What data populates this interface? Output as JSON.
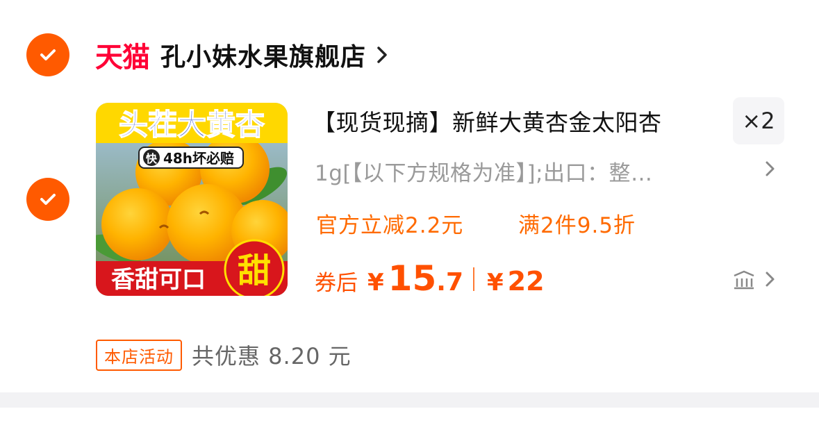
{
  "shop": {
    "platform": "天猫",
    "name": "孔小妹水果旗舰店"
  },
  "image_text": {
    "headline": "头茬大黄杏",
    "badge_kuai": "快",
    "badge_text": "48h坏必赔",
    "bottom_left": "香甜可口",
    "bottom_right": "甜"
  },
  "item": {
    "title": "【现货现摘】新鲜大黄杏金太阳杏",
    "quantity": "×2",
    "spec": "1g[【以下方规格为准】];出口：整…",
    "promo_1": "官方立减2.2元",
    "promo_2": "满2件9.5折",
    "after_coupon_label": "券后",
    "currency": "¥",
    "price_int": "15",
    "price_dec": ".7",
    "original_currency": "¥",
    "original_price": "22"
  },
  "activity": {
    "badge": "本店活动",
    "text": "共优惠 8.20 元"
  },
  "colors": {
    "accent": "#ff5a00",
    "tmall_red": "#ff0036",
    "promo_orange": "#ff6a00"
  }
}
